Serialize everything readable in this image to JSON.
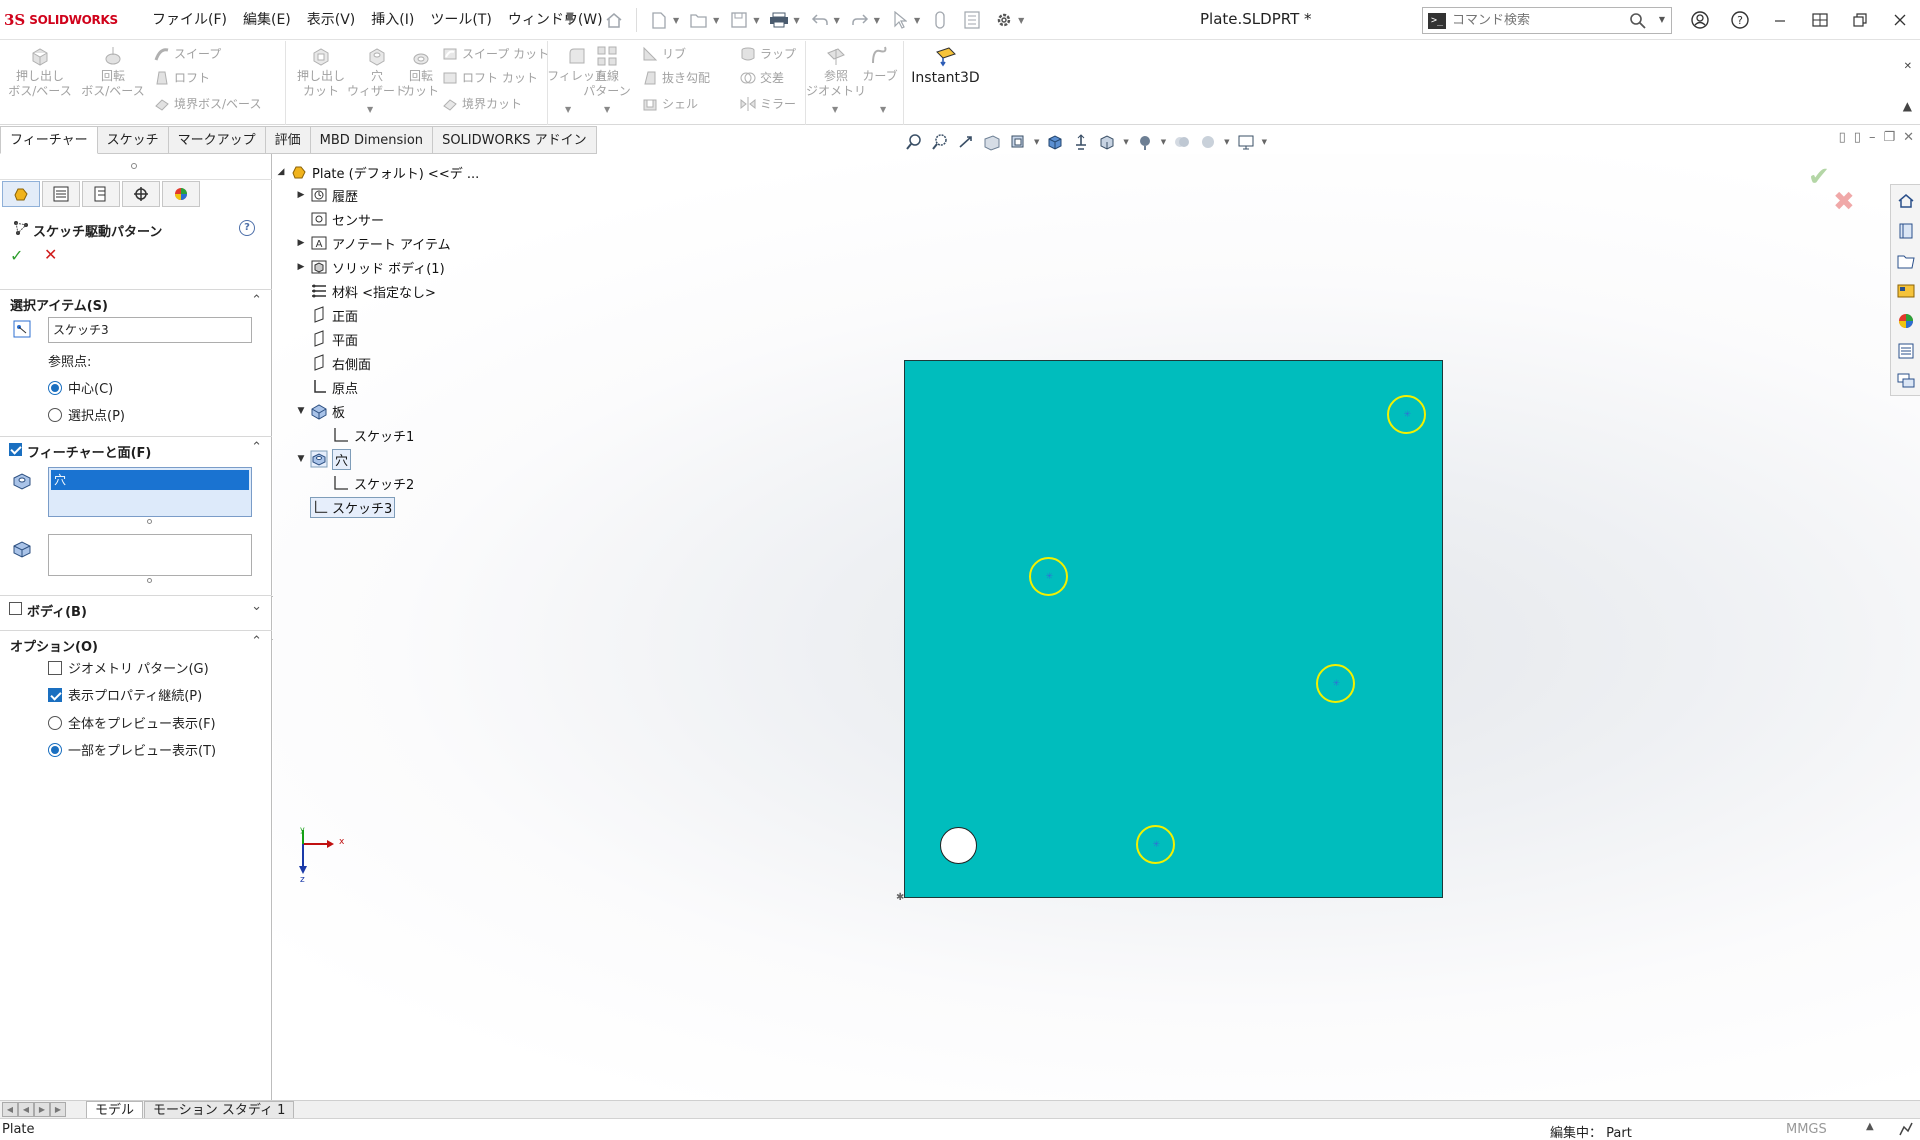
{
  "app": {
    "logo_mark": "3S",
    "brand": "SOLIDWORKS",
    "doc_title": "Plate.SLDPRT *"
  },
  "menu": [
    "ファイル(F)",
    "編集(E)",
    "表示(V)",
    "挿入(I)",
    "ツール(T)",
    "ウィンドウ(W)"
  ],
  "search": {
    "placeholder": "コマンド検索",
    "prompt_glyph": ">_"
  },
  "ribbon": {
    "extrude_boss": "押し出し\nボス/ベース",
    "revolve_boss": "回転\nボス/ベース",
    "sweep": "スイープ",
    "loft": "ロフト",
    "boundary_boss": "境界ボス/ベース",
    "extrude_cut": "押し出し\nカット",
    "hole_wizard": "穴\nウィザード",
    "revolve_cut": "回転\nカット",
    "sweep_cut": "スイープ カット",
    "loft_cut": "ロフト カット",
    "boundary_cut": "境界カット",
    "fillet": "フィレット",
    "linear_pattern": "直線\nパターン",
    "rib": "リブ",
    "draft": "抜き勾配",
    "shell": "シェル",
    "wrap": "ラップ",
    "intersect": "交差",
    "mirror": "ミラー",
    "ref_geometry": "参照\nジオメトリ",
    "curves": "カーブ",
    "instant3d": "Instant3D"
  },
  "cmd_tabs": [
    "フィーチャー",
    "スケッチ",
    "マークアップ",
    "評価",
    "MBD Dimension",
    "SOLIDWORKS アドイン"
  ],
  "property_manager": {
    "title": "スケッチ駆動パターン",
    "help": "?",
    "ok": "✓",
    "cancel": "✕",
    "selections": {
      "header": "選択アイテム(S)",
      "sketch_value": "スケッチ3",
      "ref_point_label": "参照点:",
      "radio_center": "中心(C)",
      "radio_selected": "選択点(P)"
    },
    "features_faces": {
      "header": "フィーチャーと面(F)",
      "selected_item": "穴"
    },
    "bodies": {
      "header": "ボディ(B)"
    },
    "options": {
      "header": "オプション(O)",
      "geometry_pattern": "ジオメトリ パターン(G)",
      "propagate_visual": "表示プロパティ継続(P)",
      "full_preview": "全体をプレビュー表示(F)",
      "partial_preview": "一部をプレビュー表示(T)"
    }
  },
  "tree": {
    "root": "Plate (デフォルト) <<デ ...",
    "history": "履歴",
    "sensors": "センサー",
    "annotations": "アノテート アイテム",
    "solid_bodies": "ソリッド ボディ(1)",
    "material": "材料 <指定なし>",
    "front": "正面",
    "top": "平面",
    "right": "右側面",
    "origin": "原点",
    "feat_plate": "板",
    "sketch1": "スケッチ1",
    "feat_hole": "穴",
    "sketch2": "スケッチ2",
    "sketch3": "スケッチ3"
  },
  "triad": {
    "x": "x",
    "y": "y",
    "z": "z"
  },
  "bottom_tabs": [
    "モデル",
    "モーション スタディ 1"
  ],
  "status": {
    "left": "Plate",
    "editing": "編集中： Part",
    "units": "MMGS",
    "up": "▲"
  },
  "colors": {
    "plate": "#00bdbd",
    "preview_ring": "#f3f000",
    "brand_red": "#d0021b",
    "selection_blue": "#1a73d1"
  }
}
